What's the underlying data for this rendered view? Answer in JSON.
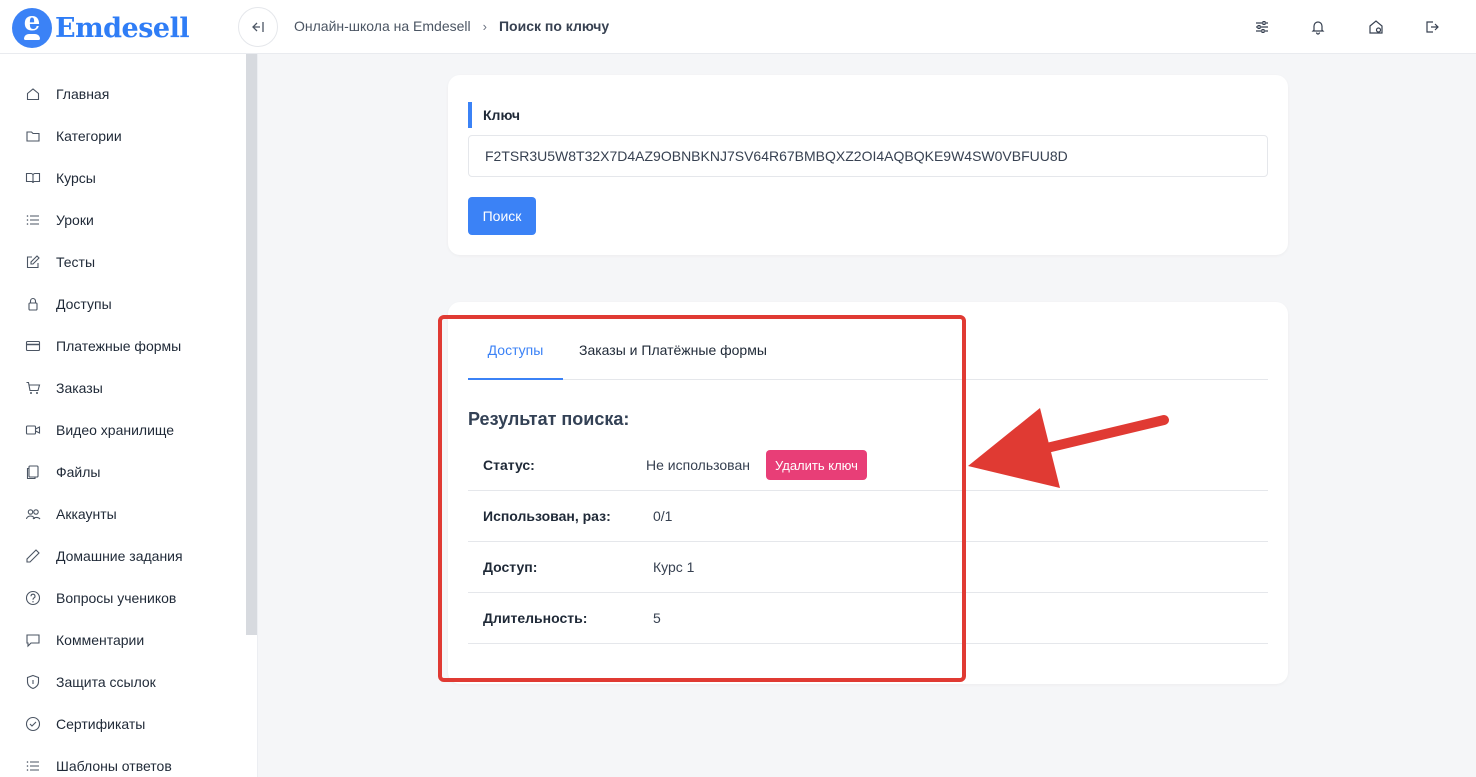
{
  "brand": {
    "name": "Emdesell",
    "mark": "e"
  },
  "header": {
    "breadcrumb": {
      "root": "Онлайн-школа на Emdesell",
      "separator": "›",
      "current": "Поиск по ключу"
    },
    "icons": [
      "sliders-icon",
      "bell-icon",
      "home-settings-icon",
      "logout-icon"
    ]
  },
  "sidebar": {
    "items": [
      {
        "label": "Главная",
        "icon": "home-icon"
      },
      {
        "label": "Категории",
        "icon": "folder-icon"
      },
      {
        "label": "Курсы",
        "icon": "book-icon"
      },
      {
        "label": "Уроки",
        "icon": "list-icon"
      },
      {
        "label": "Тесты",
        "icon": "edit-icon"
      },
      {
        "label": "Доступы",
        "icon": "lock-icon"
      },
      {
        "label": "Платежные формы",
        "icon": "card-icon"
      },
      {
        "label": "Заказы",
        "icon": "cart-icon"
      },
      {
        "label": "Видео хранилище",
        "icon": "video-icon"
      },
      {
        "label": "Файлы",
        "icon": "files-icon"
      },
      {
        "label": "Аккаунты",
        "icon": "users-icon"
      },
      {
        "label": "Домашние задания",
        "icon": "pencil-icon"
      },
      {
        "label": "Вопросы учеников",
        "icon": "question-icon"
      },
      {
        "label": "Комментарии",
        "icon": "comment-icon"
      },
      {
        "label": "Защита ссылок",
        "icon": "shield-icon"
      },
      {
        "label": "Сертификаты",
        "icon": "check-circle-icon"
      },
      {
        "label": "Шаблоны ответов",
        "icon": "list-icon"
      }
    ]
  },
  "search": {
    "label": "Ключ",
    "value": "F2TSR3U5W8T32X7D4AZ9OBNBKNJ7SV64R67BMBQXZ2OI4AQBQKE9W4SW0VBFUU8D",
    "button": "Поиск"
  },
  "results": {
    "tabs": [
      {
        "label": "Доступы",
        "active": true
      },
      {
        "label": "Заказы и Платёжные формы",
        "active": false
      }
    ],
    "title": "Результат поиска:",
    "rows": [
      {
        "label": "Статус:",
        "value": "Не использован"
      },
      {
        "label": "Использован, раз:",
        "value": "0/1"
      },
      {
        "label": "Доступ:",
        "value": "Курс 1"
      },
      {
        "label": "Длительность:",
        "value": "5"
      }
    ],
    "delete_button": "Удалить ключ"
  },
  "colors": {
    "accent": "#3b82f6",
    "danger": "#e83e77",
    "annotation": "#e03a33"
  }
}
